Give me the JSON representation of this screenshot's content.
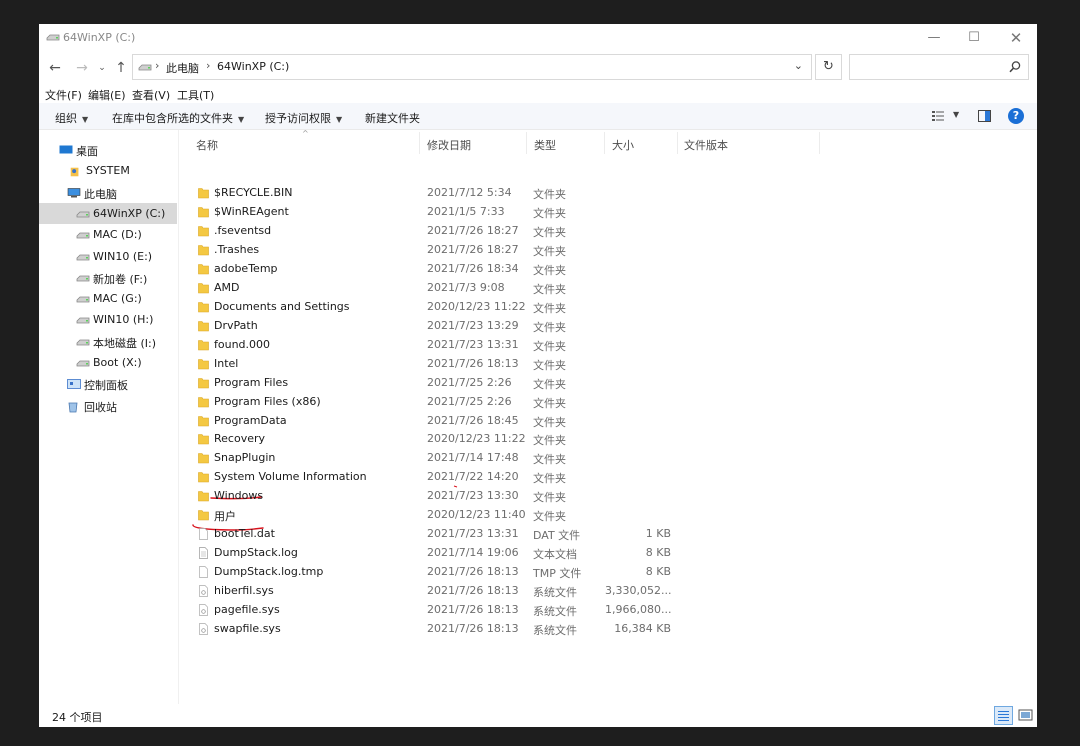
{
  "window": {
    "title": "64WinXP  (C:)",
    "controls": {
      "minimize": "—",
      "maximize": "☐",
      "close": "✕"
    }
  },
  "address": {
    "crumbs": [
      "此电脑",
      "64WinXP  (C:)"
    ],
    "search_placeholder": ""
  },
  "menu": [
    "文件(F)",
    "编辑(E)",
    "查看(V)",
    "工具(T)"
  ],
  "commands": [
    "组织",
    "在库中包含所选的文件夹",
    "授予访问权限",
    "新建文件夹"
  ],
  "nav": [
    {
      "label": "桌面",
      "icon": "desktop-icon"
    },
    {
      "label": "SYSTEM",
      "icon": "user-icon"
    },
    {
      "label": "此电脑",
      "icon": "computer-icon"
    },
    {
      "label": "64WinXP  (C:)",
      "icon": "drive-icon",
      "selected": true
    },
    {
      "label": "MAC (D:)",
      "icon": "drive-icon"
    },
    {
      "label": "WIN10 (E:)",
      "icon": "drive-icon"
    },
    {
      "label": "新加卷 (F:)",
      "icon": "drive-icon"
    },
    {
      "label": "MAC (G:)",
      "icon": "drive-icon"
    },
    {
      "label": "WIN10 (H:)",
      "icon": "drive-icon"
    },
    {
      "label": "本地磁盘 (I:)",
      "icon": "drive-icon"
    },
    {
      "label": "Boot (X:)",
      "icon": "drive-icon"
    },
    {
      "label": "控制面板",
      "icon": "control-panel-icon"
    },
    {
      "label": "回收站",
      "icon": "recycle-bin-icon"
    }
  ],
  "columns": [
    "名称",
    "修改日期",
    "类型",
    "大小",
    "文件版本"
  ],
  "files": [
    {
      "name": "$RECYCLE.BIN",
      "date": "2021/7/12 5:34",
      "type": "文件夹",
      "size": "",
      "kind": "folder"
    },
    {
      "name": "$WinREAgent",
      "date": "2021/1/5 7:33",
      "type": "文件夹",
      "size": "",
      "kind": "folder"
    },
    {
      "name": ".fseventsd",
      "date": "2021/7/26 18:27",
      "type": "文件夹",
      "size": "",
      "kind": "folder"
    },
    {
      "name": ".Trashes",
      "date": "2021/7/26 18:27",
      "type": "文件夹",
      "size": "",
      "kind": "folder"
    },
    {
      "name": "adobeTemp",
      "date": "2021/7/26 18:34",
      "type": "文件夹",
      "size": "",
      "kind": "folder"
    },
    {
      "name": "AMD",
      "date": "2021/7/3 9:08",
      "type": "文件夹",
      "size": "",
      "kind": "folder"
    },
    {
      "name": "Documents and Settings",
      "date": "2020/12/23 11:22",
      "type": "文件夹",
      "size": "",
      "kind": "folder"
    },
    {
      "name": "DrvPath",
      "date": "2021/7/23 13:29",
      "type": "文件夹",
      "size": "",
      "kind": "folder"
    },
    {
      "name": "found.000",
      "date": "2021/7/23 13:31",
      "type": "文件夹",
      "size": "",
      "kind": "folder"
    },
    {
      "name": "Intel",
      "date": "2021/7/26 18:13",
      "type": "文件夹",
      "size": "",
      "kind": "folder"
    },
    {
      "name": "Program Files",
      "date": "2021/7/25 2:26",
      "type": "文件夹",
      "size": "",
      "kind": "folder"
    },
    {
      "name": "Program Files (x86)",
      "date": "2021/7/25 2:26",
      "type": "文件夹",
      "size": "",
      "kind": "folder"
    },
    {
      "name": "ProgramData",
      "date": "2021/7/26 18:45",
      "type": "文件夹",
      "size": "",
      "kind": "folder"
    },
    {
      "name": "Recovery",
      "date": "2020/12/23 11:22",
      "type": "文件夹",
      "size": "",
      "kind": "folder"
    },
    {
      "name": "SnapPlugin",
      "date": "2021/7/14 17:48",
      "type": "文件夹",
      "size": "",
      "kind": "folder"
    },
    {
      "name": "System Volume Information",
      "date": "2021/7/22 14:20",
      "type": "文件夹",
      "size": "",
      "kind": "folder"
    },
    {
      "name": "Windows",
      "date": "2021/7/23 13:30",
      "type": "文件夹",
      "size": "",
      "kind": "folder"
    },
    {
      "name": "用户",
      "date": "2020/12/23 11:40",
      "type": "文件夹",
      "size": "",
      "kind": "folder"
    },
    {
      "name": "bootTel.dat",
      "date": "2021/7/23 13:31",
      "type": "DAT 文件",
      "size": "1 KB",
      "kind": "file"
    },
    {
      "name": "DumpStack.log",
      "date": "2021/7/14 19:06",
      "type": "文本文档",
      "size": "8 KB",
      "kind": "text"
    },
    {
      "name": "DumpStack.log.tmp",
      "date": "2021/7/26 18:13",
      "type": "TMP 文件",
      "size": "8 KB",
      "kind": "file"
    },
    {
      "name": "hiberfil.sys",
      "date": "2021/7/26 18:13",
      "type": "系统文件",
      "size": "3,330,052...",
      "kind": "sys"
    },
    {
      "name": "pagefile.sys",
      "date": "2021/7/26 18:13",
      "type": "系统文件",
      "size": "1,966,080...",
      "kind": "sys"
    },
    {
      "name": "swapfile.sys",
      "date": "2021/7/26 18:13",
      "type": "系统文件",
      "size": "16,384 KB",
      "kind": "sys"
    }
  ],
  "status": {
    "count": "24 个项目"
  },
  "colors": {
    "folder": "#f4c842",
    "accent": "#1a6fd6",
    "annotation": "#d9121c",
    "selected": "#d9d9d9"
  }
}
